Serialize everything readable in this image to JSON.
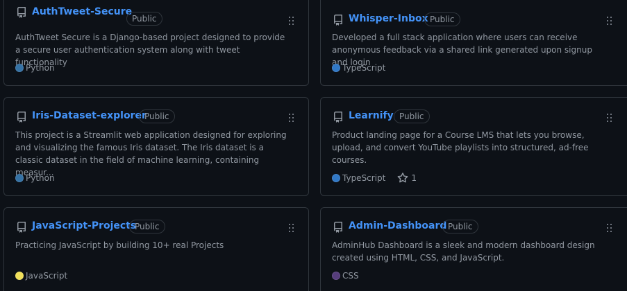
{
  "repos": [
    {
      "name": "AuthTweet-Secure",
      "visibility": "Public",
      "description": "AuthTweet Secure is a Django-based project designed to provide a secure user authentication system along with tweet functionality",
      "language": "Python",
      "language_color": "#3572A5",
      "stars": null
    },
    {
      "name": "Whisper-Inbox",
      "visibility": "Public",
      "description": "Developed a full stack application where users can receive anonymous feedback via a shared link generated upon signup and login",
      "language": "TypeScript",
      "language_color": "#3178c6",
      "stars": null
    },
    {
      "name": "Iris-Dataset-explorer",
      "visibility": "Public",
      "description": "This project is a Streamlit web application designed for exploring and visualizing the famous Iris dataset. The Iris dataset is a classic dataset in the field of machine learning, containing measur...",
      "language": "Python",
      "language_color": "#3572A5",
      "stars": null
    },
    {
      "name": "Learnify",
      "visibility": "Public",
      "description": "Product landing page for a Course LMS that lets you browse, upload, and convert YouTube playlists into structured, ad-free courses.",
      "language": "TypeScript",
      "language_color": "#3178c6",
      "stars": "1"
    },
    {
      "name": "JavaScript-Projects",
      "visibility": "Public",
      "description": "Practicing JavaScript by building 10+ real Projects",
      "language": "JavaScript",
      "language_color": "#f1e05a",
      "stars": null
    },
    {
      "name": "Admin-Dashboard",
      "visibility": "Public",
      "description": "AdminHub Dashboard is a sleek and modern dashboard design created using HTML, CSS, and JavaScript.",
      "language": "CSS",
      "language_color": "#563d7c",
      "stars": null
    }
  ],
  "icons": {
    "repo": "repo-icon",
    "drag": "grabber-icon",
    "star": "star-icon"
  }
}
